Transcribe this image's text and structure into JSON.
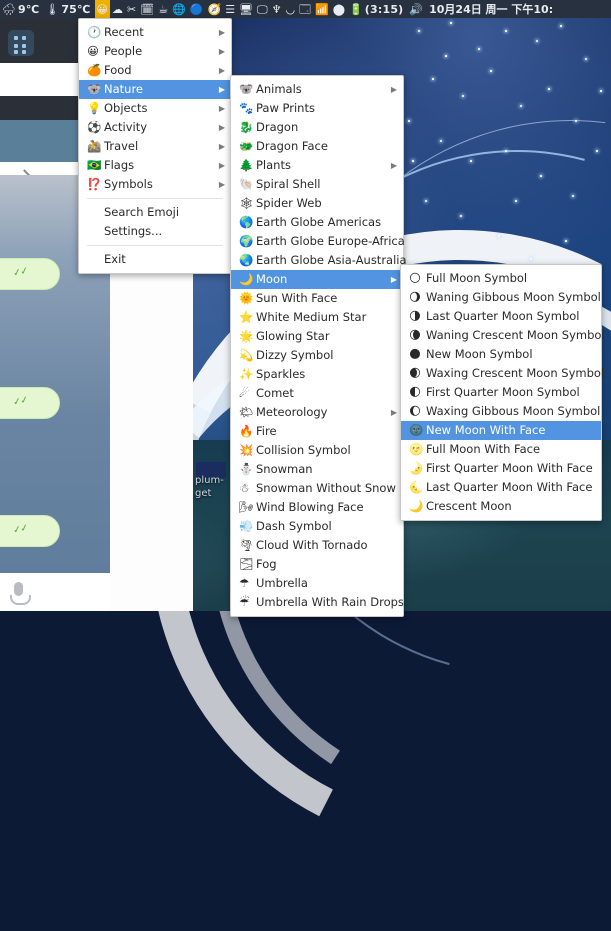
{
  "topbar": {
    "items": [
      {
        "name": "weather-indicator",
        "icon": "🌧",
        "text": "9℃"
      },
      {
        "name": "temperature-indicator",
        "icon": "🌡",
        "text": "75℃"
      },
      {
        "name": "emoji-picker-indicator",
        "icon": "😀",
        "text": "",
        "highlight": true
      },
      {
        "name": "cloud-sync-icon",
        "icon": "☁",
        "text": ""
      },
      {
        "name": "scissors-icon",
        "icon": "✂",
        "text": ""
      },
      {
        "name": "calendar-icon",
        "icon": "🗓",
        "text": ""
      },
      {
        "name": "coffee-icon",
        "icon": "☕",
        "text": ""
      },
      {
        "name": "globe-icon",
        "icon": "🌐",
        "text": ""
      },
      {
        "name": "bluetooth-icon",
        "icon": "🔵",
        "text": ""
      },
      {
        "name": "navigation-icon",
        "icon": "🧭",
        "text": ""
      },
      {
        "name": "list-menu-icon",
        "icon": "☰",
        "text": ""
      },
      {
        "name": "display-icon",
        "icon": "🖥",
        "text": ""
      },
      {
        "name": "monitor-icon",
        "icon": "🖵",
        "text": ""
      },
      {
        "name": "trident-icon",
        "icon": "♆",
        "text": ""
      },
      {
        "name": "shield-icon",
        "icon": "◡",
        "text": ""
      },
      {
        "name": "device-icon",
        "icon": "🗔",
        "text": ""
      },
      {
        "name": "wifi-icon",
        "icon": "📶",
        "text": ""
      },
      {
        "name": "dark-circle-icon",
        "icon": "⬤",
        "text": ""
      },
      {
        "name": "battery-icon",
        "icon": "🔋",
        "text": "(3:15)"
      },
      {
        "name": "volume-icon",
        "icon": "🔊",
        "text": ""
      }
    ],
    "clock": "10月24日 周一 下午10:"
  },
  "menus": {
    "categories": {
      "items": [
        {
          "emoji": "🕐",
          "label": "Recent",
          "arrow": true,
          "selected": false
        },
        {
          "emoji": "😀",
          "label": "People",
          "arrow": true,
          "selected": false
        },
        {
          "emoji": "🍊",
          "label": "Food",
          "arrow": true,
          "selected": false
        },
        {
          "emoji": "🐨",
          "label": "Nature",
          "arrow": true,
          "selected": true
        },
        {
          "emoji": "💡",
          "label": "Objects",
          "arrow": true,
          "selected": false
        },
        {
          "emoji": "⚽",
          "label": "Activity",
          "arrow": true,
          "selected": false
        },
        {
          "emoji": "🚵",
          "label": "Travel",
          "arrow": true,
          "selected": false
        },
        {
          "emoji": "🇧🇷",
          "label": "Flags",
          "arrow": true,
          "selected": false
        },
        {
          "emoji": "⁉️",
          "label": "Symbols",
          "arrow": true,
          "selected": false
        }
      ],
      "actions_primary": [
        "Search Emoji",
        "Settings..."
      ],
      "actions_secondary": [
        "Exit"
      ]
    },
    "nature": {
      "items": [
        {
          "emoji": "🐨",
          "label": "Animals",
          "arrow": true,
          "selected": false
        },
        {
          "emoji": "🐾",
          "label": "Paw Prints",
          "arrow": false,
          "selected": false
        },
        {
          "emoji": "🐉",
          "label": "Dragon",
          "arrow": false,
          "selected": false
        },
        {
          "emoji": "🐲",
          "label": "Dragon Face",
          "arrow": false,
          "selected": false
        },
        {
          "emoji": "🌲",
          "label": "Plants",
          "arrow": true,
          "selected": false
        },
        {
          "emoji": "🐚",
          "label": "Spiral Shell",
          "arrow": false,
          "selected": false
        },
        {
          "emoji": "🕸",
          "label": "Spider Web",
          "arrow": false,
          "selected": false
        },
        {
          "emoji": "🌎",
          "label": "Earth Globe Americas",
          "arrow": false,
          "selected": false
        },
        {
          "emoji": "🌍",
          "label": "Earth Globe Europe-Africa",
          "arrow": false,
          "selected": false
        },
        {
          "emoji": "🌏",
          "label": "Earth Globe Asia-Australia",
          "arrow": false,
          "selected": false
        },
        {
          "emoji": "🌙",
          "label": "Moon",
          "arrow": true,
          "selected": true
        },
        {
          "emoji": "🌞",
          "label": "Sun With Face",
          "arrow": false,
          "selected": false
        },
        {
          "emoji": "⭐",
          "label": "White Medium Star",
          "arrow": false,
          "selected": false
        },
        {
          "emoji": "🌟",
          "label": "Glowing Star",
          "arrow": false,
          "selected": false
        },
        {
          "emoji": "💫",
          "label": "Dizzy Symbol",
          "arrow": false,
          "selected": false
        },
        {
          "emoji": "✨",
          "label": "Sparkles",
          "arrow": false,
          "selected": false
        },
        {
          "emoji": "☄",
          "label": "Comet",
          "arrow": false,
          "selected": false
        },
        {
          "emoji": "🌤",
          "label": "Meteorology",
          "arrow": true,
          "selected": false
        },
        {
          "emoji": "🔥",
          "label": "Fire",
          "arrow": false,
          "selected": false
        },
        {
          "emoji": "💥",
          "label": "Collision Symbol",
          "arrow": false,
          "selected": false
        },
        {
          "emoji": "⛄",
          "label": "Snowman",
          "arrow": false,
          "selected": false
        },
        {
          "emoji": "☃",
          "label": "Snowman Without Snow",
          "arrow": false,
          "selected": false
        },
        {
          "emoji": "🌬",
          "label": "Wind Blowing Face",
          "arrow": false,
          "selected": false
        },
        {
          "emoji": "💨",
          "label": "Dash Symbol",
          "arrow": false,
          "selected": false
        },
        {
          "emoji": "🌪",
          "label": "Cloud With Tornado",
          "arrow": false,
          "selected": false
        },
        {
          "emoji": "🌫",
          "label": "Fog",
          "arrow": false,
          "selected": false
        },
        {
          "emoji": "☂",
          "label": "Umbrella",
          "arrow": false,
          "selected": false
        },
        {
          "emoji": "☔",
          "label": "Umbrella With Rain Drops",
          "arrow": false,
          "selected": false
        }
      ]
    },
    "moon": {
      "items": [
        {
          "emoji": "🌕",
          "label": "Full Moon Symbol",
          "arrow": false,
          "selected": false
        },
        {
          "emoji": "🌖",
          "label": "Waning Gibbous Moon Symbol",
          "arrow": false,
          "selected": false
        },
        {
          "emoji": "🌗",
          "label": "Last Quarter Moon Symbol",
          "arrow": false,
          "selected": false
        },
        {
          "emoji": "🌘",
          "label": "Waning Crescent Moon Symbol",
          "arrow": false,
          "selected": false
        },
        {
          "emoji": "🌑",
          "label": "New Moon Symbol",
          "arrow": false,
          "selected": false
        },
        {
          "emoji": "🌒",
          "label": "Waxing Crescent Moon Symbol",
          "arrow": false,
          "selected": false
        },
        {
          "emoji": "🌓",
          "label": "First Quarter Moon Symbol",
          "arrow": false,
          "selected": false
        },
        {
          "emoji": "🌔",
          "label": "Waxing Gibbous Moon Symbol",
          "arrow": false,
          "selected": false
        },
        {
          "emoji": "🌚",
          "label": "New Moon With Face",
          "arrow": false,
          "selected": true
        },
        {
          "emoji": "🌝",
          "label": "Full Moon With Face",
          "arrow": false,
          "selected": false
        },
        {
          "emoji": "🌛",
          "label": "First Quarter Moon With Face",
          "arrow": false,
          "selected": false
        },
        {
          "emoji": "🌜",
          "label": "Last Quarter Moon With Face",
          "arrow": false,
          "selected": false
        },
        {
          "emoji": "🌙",
          "label": "Crescent Moon",
          "arrow": false,
          "selected": false
        }
      ]
    }
  },
  "desktop": {
    "icon_label": "plum-get"
  },
  "colors": {
    "panel_bg": "#27313f",
    "menu_bg": "#ffffff",
    "menu_selection": "#5294e2",
    "menu_text": "#2a2a2a",
    "emoji_indicator_highlight": "#f0b000"
  }
}
